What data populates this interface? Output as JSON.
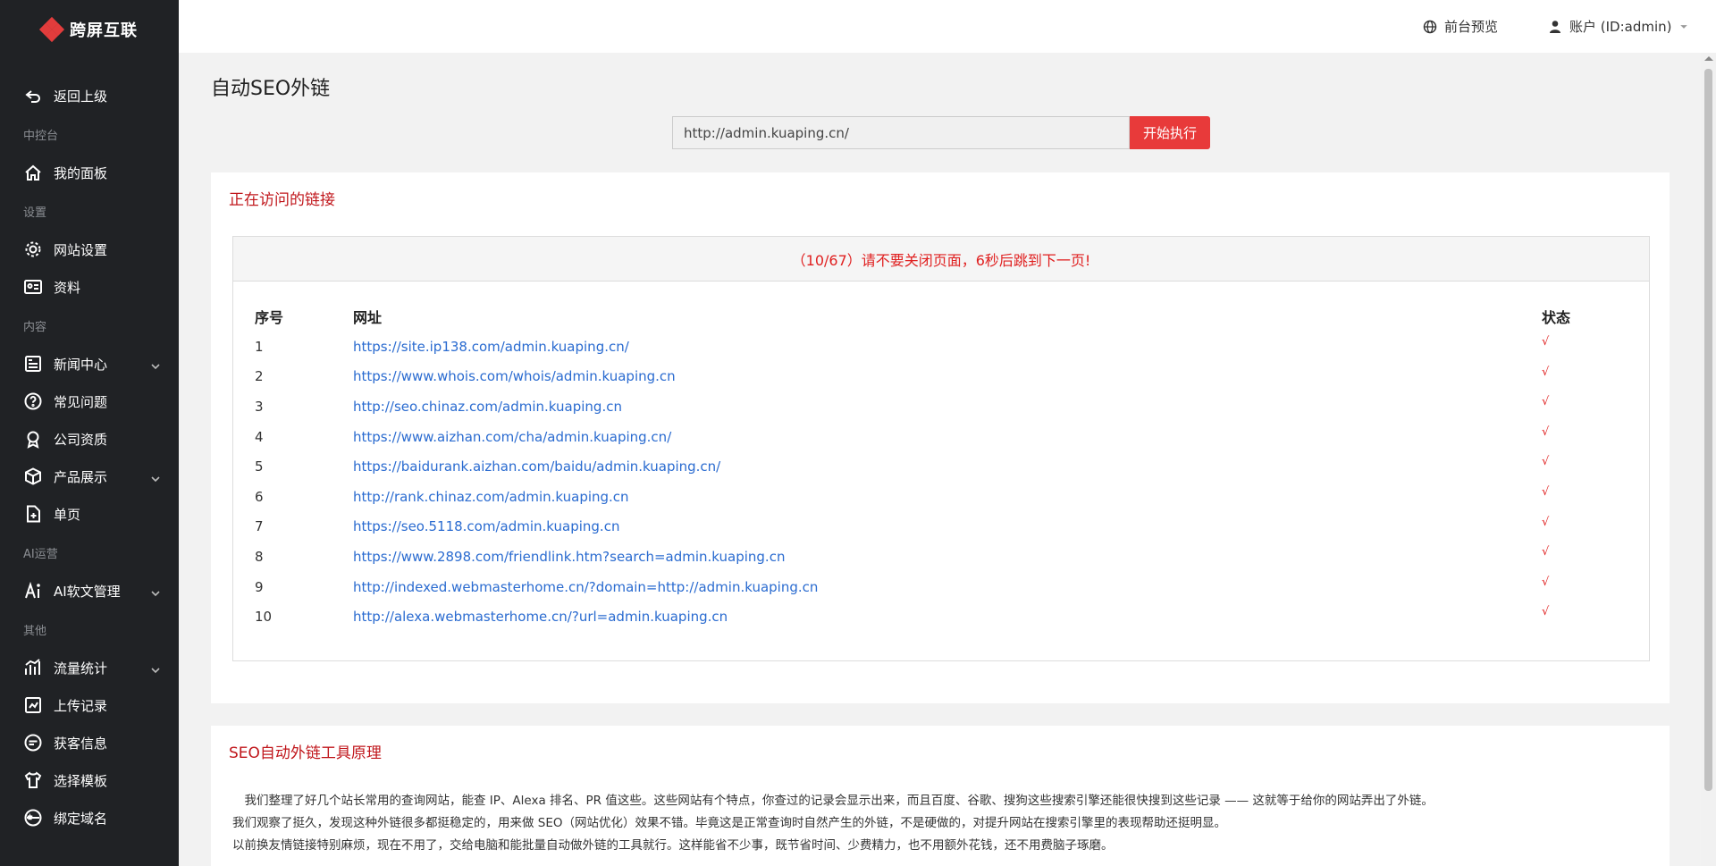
{
  "brand": {
    "name": "跨屏互联",
    "color": "#e23c3c"
  },
  "sidebar": {
    "items": [
      {
        "type": "item",
        "label": "返回上级",
        "icon": "back-arrow-icon"
      },
      {
        "type": "section",
        "label": "中控台"
      },
      {
        "type": "item",
        "label": "我的面板",
        "icon": "home-icon"
      },
      {
        "type": "section",
        "label": "设置"
      },
      {
        "type": "item",
        "label": "网站设置",
        "icon": "gear-icon"
      },
      {
        "type": "item",
        "label": "资料",
        "icon": "id-card-icon"
      },
      {
        "type": "section",
        "label": "内容"
      },
      {
        "type": "item",
        "label": "新闻中心",
        "icon": "news-icon",
        "expandable": true
      },
      {
        "type": "item",
        "label": "常见问题",
        "icon": "question-icon"
      },
      {
        "type": "item",
        "label": "公司资质",
        "icon": "award-icon"
      },
      {
        "type": "item",
        "label": "产品展示",
        "icon": "cube-icon",
        "expandable": true
      },
      {
        "type": "item",
        "label": "单页",
        "icon": "file-plus-icon"
      },
      {
        "type": "section",
        "label": "AI运营"
      },
      {
        "type": "item",
        "label": "AI软文管理",
        "icon": "ai-icon",
        "expandable": true
      },
      {
        "type": "section",
        "label": "其他"
      },
      {
        "type": "item",
        "label": "流量统计",
        "icon": "chart-icon",
        "expandable": true
      },
      {
        "type": "item",
        "label": "上传记录",
        "icon": "upload-log-icon"
      },
      {
        "type": "item",
        "label": "获客信息",
        "icon": "message-icon"
      },
      {
        "type": "item",
        "label": "选择模板",
        "icon": "shirt-icon"
      },
      {
        "type": "item",
        "label": "绑定域名",
        "icon": "www-icon"
      }
    ]
  },
  "header": {
    "preview_label": "前台预览",
    "account_label": "账户 (ID:admin)"
  },
  "main": {
    "title": "自动SEO外链",
    "url_value": "http://admin.kuaping.cn/",
    "run_label": "开始执行",
    "visiting": {
      "title": "正在访问的链接",
      "progress_text": "（10/67）请不要关闭页面，6秒后跳到下一页!",
      "columns": [
        "序号",
        "网址",
        "状态"
      ],
      "rows": [
        {
          "no": "1",
          "url": "https://site.ip138.com/admin.kuaping.cn/",
          "status": "√"
        },
        {
          "no": "2",
          "url": "https://www.whois.com/whois/admin.kuaping.cn",
          "status": "√"
        },
        {
          "no": "3",
          "url": "http://seo.chinaz.com/admin.kuaping.cn",
          "status": "√"
        },
        {
          "no": "4",
          "url": "https://www.aizhan.com/cha/admin.kuaping.cn/",
          "status": "√"
        },
        {
          "no": "5",
          "url": "https://baidurank.aizhan.com/baidu/admin.kuaping.cn/",
          "status": "√"
        },
        {
          "no": "6",
          "url": "http://rank.chinaz.com/admin.kuaping.cn",
          "status": "√"
        },
        {
          "no": "7",
          "url": "https://seo.5118.com/admin.kuaping.cn",
          "status": "√"
        },
        {
          "no": "8",
          "url": "https://www.2898.com/friendlink.htm?search=admin.kuaping.cn",
          "status": "√"
        },
        {
          "no": "9",
          "url": "http://indexed.webmasterhome.cn/?domain=http://admin.kuaping.cn",
          "status": "√"
        },
        {
          "no": "10",
          "url": "http://alexa.webmasterhome.cn/?url=admin.kuaping.cn",
          "status": "√"
        }
      ]
    },
    "principle": {
      "title": "SEO自动外链工具原理",
      "paragraphs": [
        "　我们整理了好几个站长常用的查询网站，能查 IP、Alexa 排名、PR 值这些。这些网站有个特点，你查过的记录会显示出来，而且百度、谷歌、搜狗这些搜索引擎还能很快搜到这些记录 —— 这就等于给你的网站弄出了外链。",
        "我们观察了挺久，发现这种外链很多都挺稳定的，用来做 SEO（网站优化）效果不错。毕竟这是正常查询时自然产生的外链，不是硬做的，对提升网站在搜索引擎里的表现帮助还挺明显。",
        "以前换友情链接特别麻烦，现在不用了，交给电脑和能批量自动做外链的工具就行。这样能省不少事，既节省时间、少费精力，也不用额外花钱，还不用费脑子琢磨。"
      ]
    }
  }
}
